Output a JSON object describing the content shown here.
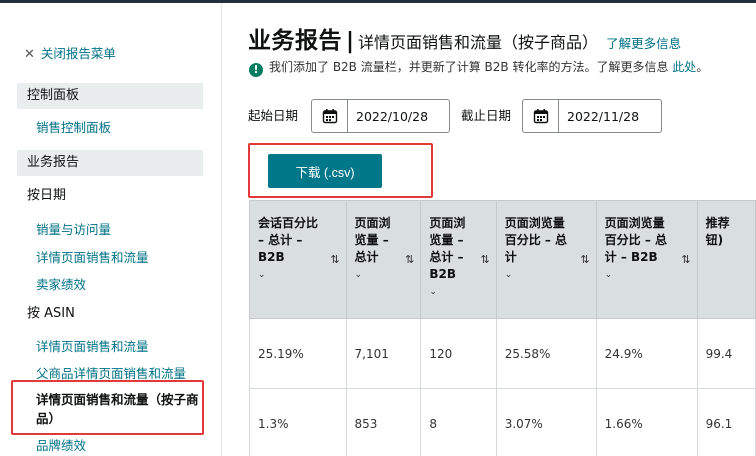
{
  "sidebar": {
    "close_label": "关闭报告菜单",
    "sec_dashboard": "控制面板",
    "link_sales_dashboard": "销售控制面板",
    "sec_reports": "业务报告",
    "group_by_date": "按日期",
    "link_sales_traffic": "销量与访问量",
    "link_detail_page_sales": "详情页面销售和流量",
    "link_seller_perf": "卖家绩效",
    "group_by_asin": "按 ASIN",
    "link_asin_detail": "详情页面销售和流量",
    "link_parent_detail": "父商品详情页面销售和流量",
    "active_item": "详情页面销售和流量（按子商品）",
    "link_brand_perf": "品牌绩效"
  },
  "header": {
    "title": "业务报告",
    "separator": "|",
    "subtitle": "详情页面销售和流量（按子商品）",
    "more_link": "了解更多信息"
  },
  "notice": {
    "text": "我们添加了 B2B 流量栏，并更新了计算 B2B 转化率的方法。了解更多信息",
    "link": "此处",
    "end": "。"
  },
  "dates": {
    "start_label": "起始日期",
    "start_value": "2022/10/28",
    "end_label": "截止日期",
    "end_value": "2022/11/28"
  },
  "download": {
    "label": "下载 (.csv)"
  },
  "table": {
    "headers": [
      "会话百分比 – 总计 – B2B",
      "页面浏览量 – 总计",
      "页面浏览量 – 总计 – B2B",
      "页面浏览量百分比 – 总计",
      "页面浏览量百分比 – 总计 – B2B",
      "推荐钮)"
    ],
    "rows": [
      [
        "25.19%",
        "7,101",
        "120",
        "25.58%",
        "24.9%",
        "99.4"
      ],
      [
        "1.3%",
        "853",
        "8",
        "3.07%",
        "1.66%",
        "96.1"
      ]
    ]
  },
  "icons": {
    "sort": "sort-icon",
    "chevron": "chevron-down-icon",
    "calendar": "calendar-icon",
    "check": "check-circle-icon"
  },
  "colors": {
    "link": "#007185",
    "button": "#00788a",
    "highlight": "#e03a3a",
    "header_bg": "#d9dede"
  }
}
